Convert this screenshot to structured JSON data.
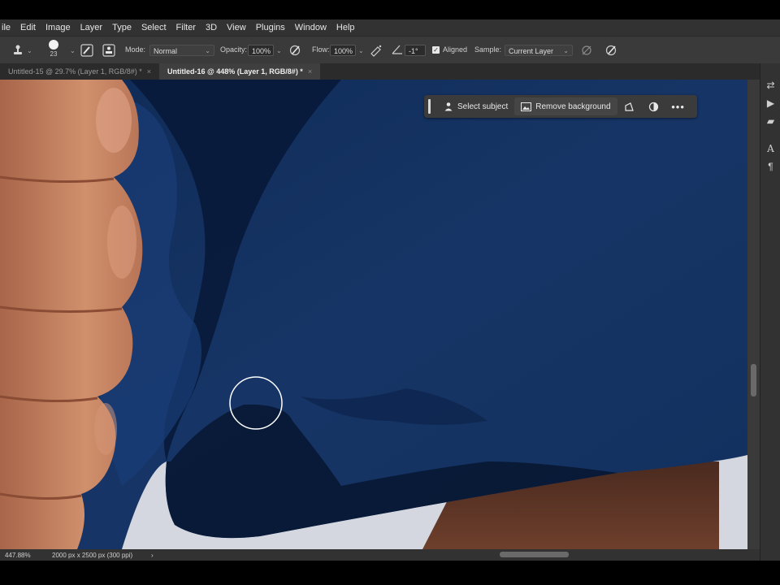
{
  "menu": [
    "ile",
    "Edit",
    "Image",
    "Layer",
    "Type",
    "Select",
    "Filter",
    "3D",
    "View",
    "Plugins",
    "Window",
    "Help"
  ],
  "options": {
    "brush_size": "23",
    "mode_label": "Mode:",
    "mode_value": "Normal",
    "opacity_label": "Opacity:",
    "opacity_value": "100%",
    "flow_label": "Flow:",
    "flow_value": "100%",
    "angle_value": "-1°",
    "aligned_label": "Aligned",
    "aligned_checked": true,
    "sample_label": "Sample:",
    "sample_value": "Current Layer"
  },
  "tabs": [
    {
      "label": "Untitled-15 @ 29.7% (Layer 1, RGB/8#) *",
      "active": false
    },
    {
      "label": "Untitled-16 @ 448% (Layer 1, RGB/8#) *",
      "active": true
    }
  ],
  "context_bar": {
    "select_subject": "Select subject",
    "remove_background": "Remove background"
  },
  "status": {
    "zoom": "447.88%",
    "doc_info": "2000 px x 2500 px (300 ppi)",
    "arrow": "›"
  },
  "right_panel_icons": [
    "history-icon",
    "play-icon",
    "comment-icon",
    "character-icon",
    "paragraph-icon"
  ],
  "colors": {
    "fabric": "#12305e",
    "skin": "#c98462",
    "ui_dark": "#323232",
    "ui_bar": "#3a3a3a"
  },
  "icons": {
    "tool": "clone-stamp-icon",
    "brush_panel": "brush-settings-icon",
    "clone_source": "clone-source-icon",
    "pressure_opacity": "pressure-opacity-icon",
    "airbrush": "airbrush-icon",
    "angle": "angle-icon",
    "ignore_adjustment": "ignore-adjustment-icon",
    "pressure_size": "pressure-size-icon"
  }
}
